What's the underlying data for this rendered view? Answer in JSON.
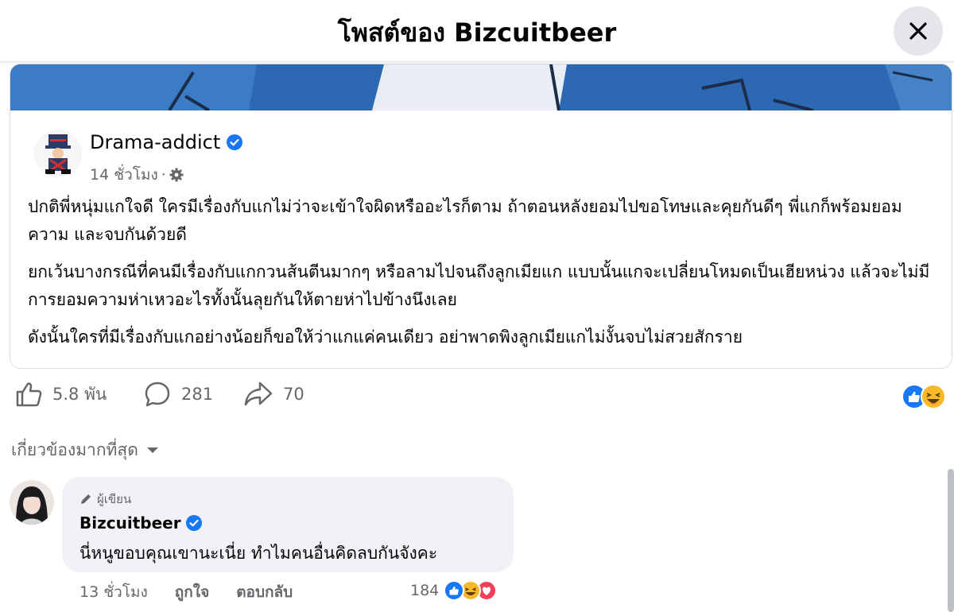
{
  "header": {
    "title": "โพสต์ของ Bizcuitbeer",
    "close_icon": "close-icon"
  },
  "shared_post": {
    "page_name": "Drama-addict",
    "verified_icon": "verified-badge-icon",
    "time": "14 ชั่วโมง",
    "separator": "·",
    "privacy_icon": "gear-icon",
    "paragraphs": [
      "ปกติพี่หนุ่มแกใจดี ใครมีเรื่องกับแกไม่ว่าจะเข้าใจผิดหรืออะไรก็ตาม ถ้าตอนหลังยอมไปขอโทษและคุยกันดีๆ พี่แกก็พร้อมยอมความ และจบกันด้วยดี",
      "ยกเว้นบางกรณีที่คนมีเรื่องกับแกกวนส้นตีนมากๆ หรือลามไปจนถึงลูกเมียแก แบบนั้นแกจะเปลี่ยนโหมดเป็นเฮียหน่วง แล้วจะไม่มีการยอมความห่าเหวอะไรทั้งนั้นลุยกันให้ตายห่าไปข้างนึงเลย",
      "ดังนั้นใครที่มีเรื่องกับแกอย่างน้อยก็ขอให้ว่าแกแค่คนเดียว อย่าพาดพิงลูกเมียแกไม่งั้นจบไม่สวยสักราย"
    ]
  },
  "actions": {
    "like_count": "5.8 พัน",
    "comment_count": "281",
    "share_count": "70",
    "colors": {
      "icon": "#65676b",
      "like_blue": "#1877f2",
      "haha_yellow": "#f7b928"
    }
  },
  "sort": {
    "label": "เกี่ยวข้องมากที่สุด"
  },
  "comment": {
    "badge": "ผู้เขียน",
    "author": "Bizcuitbeer",
    "text": "นี่หนูขอบคุณเขานะเนี่ย ทำไมคนอื่นคิดลบกันจังคะ",
    "time": "13 ชั่วโมง",
    "like_label": "ถูกใจ",
    "reply_label": "ตอบกลับ",
    "reaction_count": "184"
  }
}
